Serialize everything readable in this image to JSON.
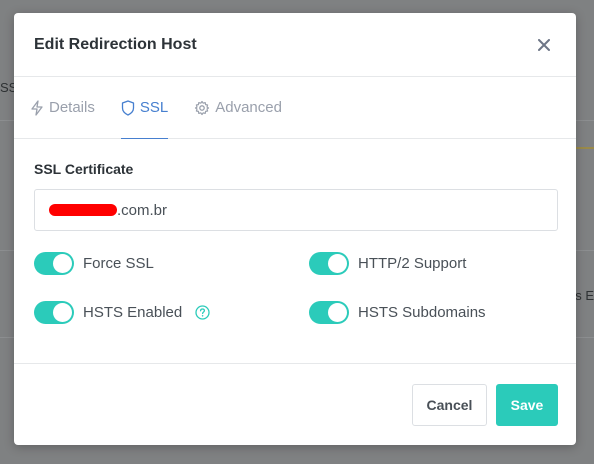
{
  "background": {
    "left_fragment": "SSI",
    "right_fragment": "'s E"
  },
  "modal": {
    "title": "Edit Redirection Host",
    "tabs": [
      {
        "label": "Details",
        "icon": "bolt-icon",
        "active": false
      },
      {
        "label": "SSL",
        "icon": "shield-icon",
        "active": true
      },
      {
        "label": "Advanced",
        "icon": "gear-icon",
        "active": false
      }
    ],
    "ssl": {
      "certificate_label": "SSL Certificate",
      "certificate_value_visible": ".com.br",
      "toggles": [
        {
          "label": "Force SSL",
          "on": true
        },
        {
          "label": "HTTP/2 Support",
          "on": true
        },
        {
          "label": "HSTS Enabled",
          "on": true,
          "help": true
        },
        {
          "label": "HSTS Subdomains",
          "on": true
        }
      ]
    },
    "footer": {
      "cancel_label": "Cancel",
      "save_label": "Save"
    }
  },
  "colors": {
    "accent_teal": "#2bcbba",
    "tab_active": "#467fcf",
    "redaction": "#ff0000"
  }
}
